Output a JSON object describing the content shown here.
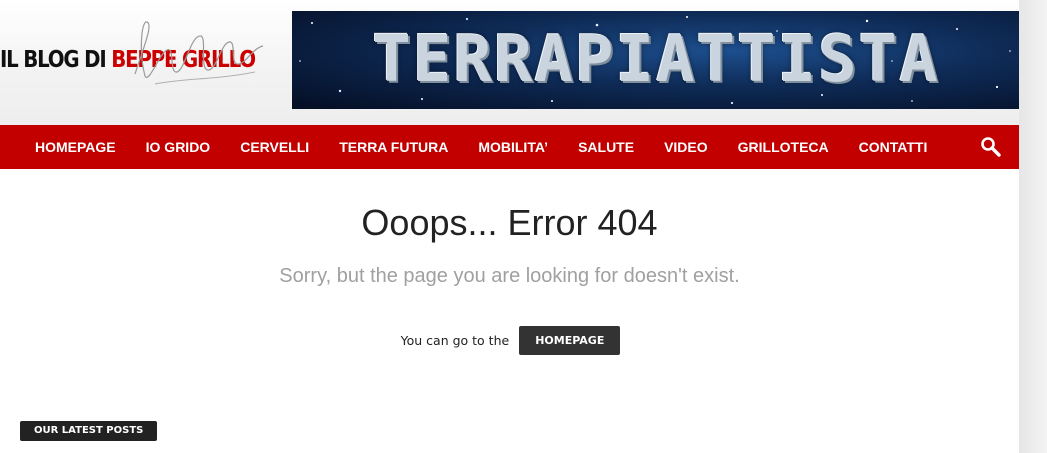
{
  "header": {
    "logo": {
      "prefix": "IL BLOG DI",
      "highlight": "BEPPE GRILLO"
    },
    "banner": {
      "text": "TERRAPIATTISTA"
    }
  },
  "nav": {
    "items": [
      {
        "label": "HOMEPAGE"
      },
      {
        "label": "IO GRIDO"
      },
      {
        "label": "CERVELLI"
      },
      {
        "label": "TERRA FUTURA"
      },
      {
        "label": "MOBILITA’"
      },
      {
        "label": "SALUTE"
      },
      {
        "label": "VIDEO"
      },
      {
        "label": "GRILLOTECA"
      },
      {
        "label": "CONTATTI"
      }
    ],
    "search_icon": "search-icon"
  },
  "error": {
    "title": "Ooops... Error 404",
    "subtitle": "Sorry, but the page you are looking for doesn't exist.",
    "go_text": "You can go to the",
    "home_button": "HOMEPAGE"
  },
  "latest": {
    "label": "OUR LATEST POSTS"
  },
  "colors": {
    "nav_red": "#c20000",
    "logo_red": "#cc0000",
    "button_dark": "#333333"
  }
}
